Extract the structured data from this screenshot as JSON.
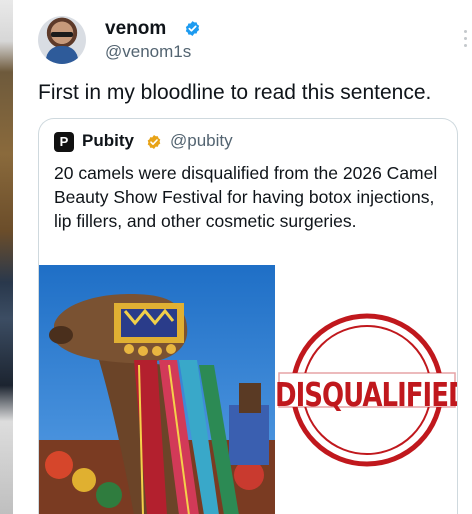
{
  "tweet": {
    "display_name": "venom",
    "handle": "@venom1s",
    "text": "First in my bloodline to read this sentence."
  },
  "quoted_tweet": {
    "display_name": "Pubity",
    "handle": "@pubity",
    "logo_letter": "P",
    "text": "20 camels were disqualified from the 2026 Camel Beauty Show Festival for having botox injections, lip fillers, and other cosmetic surgeries.",
    "stamp_text": "DISQUALIFIED"
  },
  "colors": {
    "verified_blue": "#1d9bf0",
    "gold_badge": "#e8a317",
    "stamp_red": "#c0181d",
    "secondary_text": "#536471"
  },
  "icons": {
    "verified": "verified-check-icon",
    "gold_verified": "gold-check-icon",
    "more": "more-vertical-icon"
  }
}
